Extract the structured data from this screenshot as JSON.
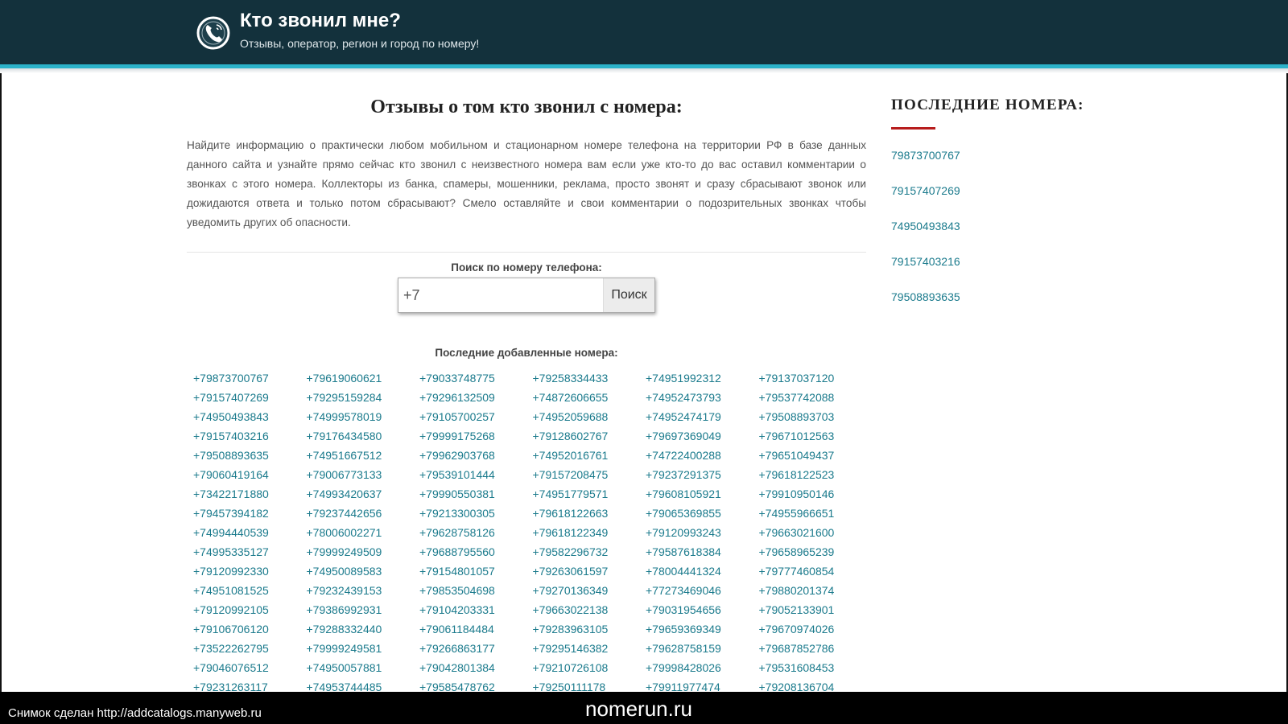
{
  "header": {
    "title": "Кто звонил мне?",
    "subtitle": "Отзывы, оператор, регион и город по номеру!",
    "icon": "phone-icon"
  },
  "main": {
    "title": "Отзывы о том кто звонил с номера:",
    "intro": "Найдите информацию о практически любом мобильном и стационарном номере телефона на территории РФ в базе данных данного сайта и узнайте прямо сейчас кто звонил с неизвестного номера вам если уже кто-то до вас оставил комментарии о звонках с этого номера. Коллекторы из банка, спамеры, мошенники, реклама, просто звонят и сразу сбрасывают звонок или дожидаются ответа и только потом сбрасывают? Смело оставляйте и свои комментарии о подозрительных звонках чтобы уведомить других об опасности."
  },
  "search": {
    "label": "Поиск по номеру телефона:",
    "value": "+7",
    "button": "Поиск"
  },
  "latest": {
    "label": "Последние добавленные номера:",
    "numbers": [
      "+79873700767",
      "+79619060621",
      "+79033748775",
      "+79258334433",
      "+74951992312",
      "+79137037120",
      "+79157407269",
      "+79295159284",
      "+79296132509",
      "+74872606655",
      "+74952473793",
      "+79537742088",
      "+74950493843",
      "+74999578019",
      "+79105700257",
      "+74952059688",
      "+74952474179",
      "+79508893703",
      "+79157403216",
      "+79176434580",
      "+79999175268",
      "+79128602767",
      "+79697369049",
      "+79671012563",
      "+79508893635",
      "+74951667512",
      "+79962903768",
      "+74952016761",
      "+74722400288",
      "+79651049437",
      "+79060419164",
      "+79006773133",
      "+79539101444",
      "+79157208475",
      "+79237291375",
      "+79618122523",
      "+73422171880",
      "+74993420637",
      "+79990550381",
      "+74951779571",
      "+79608105921",
      "+79910950146",
      "+79457394182",
      "+79237442656",
      "+79213300305",
      "+79618122663",
      "+79065369855",
      "+74955966651",
      "+74994440539",
      "+78006002271",
      "+79628758126",
      "+79618122349",
      "+79120993243",
      "+79663021600",
      "+74995335127",
      "+79999249509",
      "+79688795560",
      "+79582296732",
      "+79587618384",
      "+79658965239",
      "+79120992330",
      "+74950089583",
      "+79154801057",
      "+79263061597",
      "+78004441324",
      "+79777460854",
      "+74951081525",
      "+79232439153",
      "+79853504698",
      "+79270136349",
      "+77273469046",
      "+79880201374",
      "+79120992105",
      "+79386992931",
      "+79104203331",
      "+79663022138",
      "+79031954656",
      "+79052133901",
      "+79106706120",
      "+79288332440",
      "+79061184484",
      "+79283963105",
      "+79659369349",
      "+79670974026",
      "+73522262795",
      "+79999249581",
      "+79266863177",
      "+79295146382",
      "+79628758159",
      "+79687852786",
      "+79046076512",
      "+74950057881",
      "+79042801384",
      "+79210726108",
      "+79998428026",
      "+79531608453",
      "+79231263117",
      "+74953744485",
      "+79585478762",
      "+79250111178",
      "+79911977474",
      "+79208136704"
    ]
  },
  "sidebar": {
    "title": "ПОСЛЕДНИЕ НОМЕРА:",
    "items": [
      "79873700767",
      "79157407269",
      "74950493843",
      "79157403216",
      "79508893635"
    ]
  },
  "footer": {
    "caption": "Снимок сделан http://addcatalogs.manyweb.ru",
    "watermark": "nomerun.ru"
  },
  "colors": {
    "header_bg": "#13313c",
    "header_accent": "#2bb2c9",
    "link": "#1a7a8c",
    "sidebar_underline": "#b71c1c"
  }
}
